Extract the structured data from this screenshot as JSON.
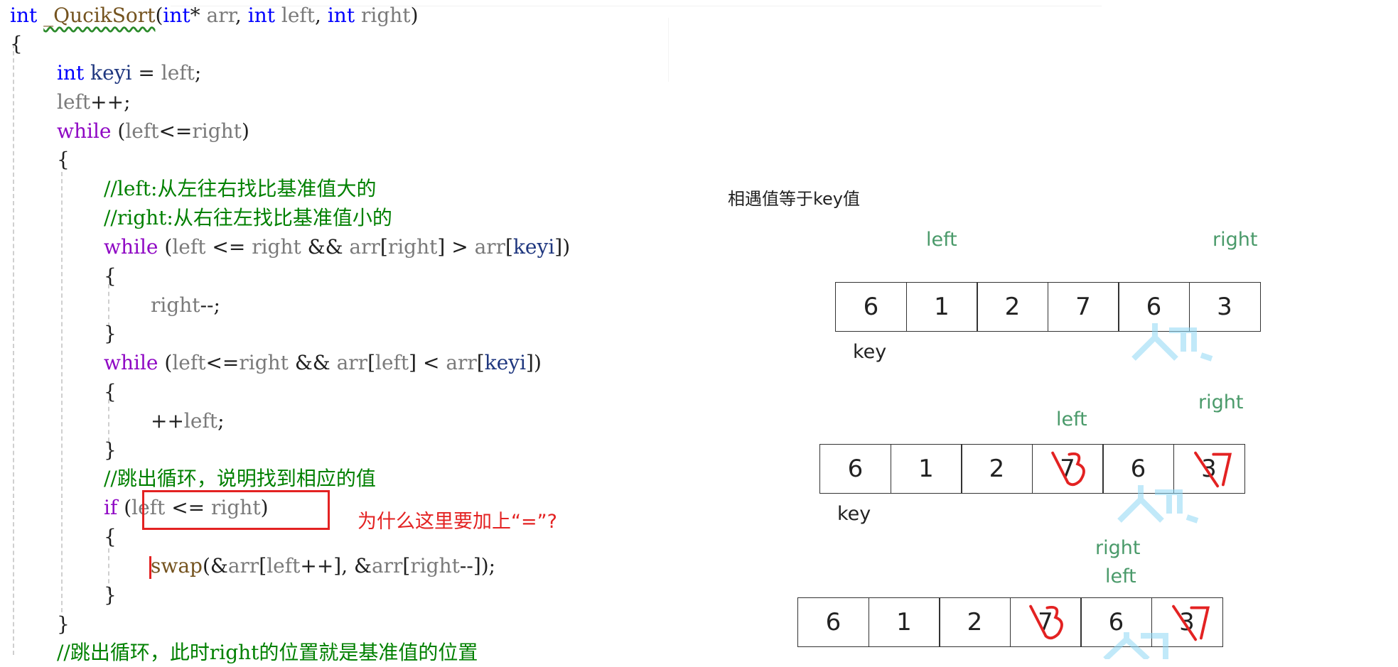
{
  "code": {
    "lines": [
      {
        "segs": [
          [
            "kw",
            "int"
          ],
          [
            "plain",
            " "
          ],
          [
            "fn sq",
            "_QucikSort"
          ],
          [
            "plain",
            "("
          ],
          [
            "kw",
            "int"
          ],
          [
            "plain",
            "* "
          ],
          [
            "id",
            "arr"
          ],
          [
            "plain",
            ", "
          ],
          [
            "kw",
            "int"
          ],
          [
            "plain",
            " "
          ],
          [
            "id",
            "left"
          ],
          [
            "plain",
            ", "
          ],
          [
            "kw",
            "int"
          ],
          [
            "plain",
            " "
          ],
          [
            "id",
            "right"
          ],
          [
            "plain",
            ")"
          ]
        ]
      },
      {
        "segs": [
          [
            "plain",
            "{"
          ]
        ]
      },
      {
        "segs": [
          [
            "kw",
            "int"
          ],
          [
            "plain",
            " "
          ],
          [
            "vr",
            "keyi"
          ],
          [
            "plain",
            " = "
          ],
          [
            "id",
            "left"
          ],
          [
            "plain",
            ";"
          ]
        ]
      },
      {
        "segs": [
          [
            "id",
            "left"
          ],
          [
            "plain",
            "++;"
          ]
        ]
      },
      {
        "segs": [
          [
            "ctl",
            "while"
          ],
          [
            "plain",
            " ("
          ],
          [
            "id",
            "left"
          ],
          [
            "plain",
            "<="
          ],
          [
            "id",
            "right"
          ],
          [
            "plain",
            ")"
          ]
        ]
      },
      {
        "segs": [
          [
            "plain",
            "{"
          ]
        ]
      },
      {
        "segs": [
          [
            "cm",
            "//left:从左往右找比基准值大的"
          ]
        ]
      },
      {
        "segs": [
          [
            "cm",
            "//right:从右往左找比基准值小的"
          ]
        ]
      },
      {
        "segs": [
          [
            "ctl",
            "while"
          ],
          [
            "plain",
            " ("
          ],
          [
            "id",
            "left"
          ],
          [
            "plain",
            " <= "
          ],
          [
            "id",
            "right"
          ],
          [
            "plain",
            " && "
          ],
          [
            "id",
            "arr"
          ],
          [
            "plain",
            "["
          ],
          [
            "id",
            "right"
          ],
          [
            "plain",
            "] > "
          ],
          [
            "id",
            "arr"
          ],
          [
            "plain",
            "["
          ],
          [
            "vr",
            "keyi"
          ],
          [
            "plain",
            "])"
          ]
        ]
      },
      {
        "segs": [
          [
            "plain",
            "{"
          ]
        ]
      },
      {
        "segs": [
          [
            "id",
            "right"
          ],
          [
            "plain",
            "--;"
          ]
        ]
      },
      {
        "segs": [
          [
            "plain",
            "}"
          ]
        ]
      },
      {
        "segs": [
          [
            "ctl",
            "while"
          ],
          [
            "plain",
            " ("
          ],
          [
            "id",
            "left"
          ],
          [
            "plain",
            "<="
          ],
          [
            "id",
            "right"
          ],
          [
            "plain",
            " && "
          ],
          [
            "id",
            "arr"
          ],
          [
            "plain",
            "["
          ],
          [
            "id",
            "left"
          ],
          [
            "plain",
            "] < "
          ],
          [
            "id",
            "arr"
          ],
          [
            "plain",
            "["
          ],
          [
            "vr",
            "keyi"
          ],
          [
            "plain",
            "])"
          ]
        ]
      },
      {
        "segs": [
          [
            "plain",
            "{"
          ]
        ]
      },
      {
        "segs": [
          [
            "plain",
            "++"
          ],
          [
            "id",
            "left"
          ],
          [
            "plain",
            ";"
          ]
        ]
      },
      {
        "segs": [
          [
            "plain",
            "}"
          ]
        ]
      },
      {
        "segs": [
          [
            "cm",
            "//跳出循环，说明找到相应的值"
          ]
        ]
      },
      {
        "segs": [
          [
            "ctl",
            "if"
          ],
          [
            "plain",
            " ("
          ],
          [
            "id",
            "left"
          ],
          [
            "plain",
            " <= "
          ],
          [
            "id",
            "right"
          ],
          [
            "plain",
            ")"
          ]
        ]
      },
      {
        "segs": [
          [
            "plain",
            "{"
          ]
        ]
      },
      {
        "segs": [
          [
            "fn",
            "swap"
          ],
          [
            "plain",
            "(&"
          ],
          [
            "id",
            "arr"
          ],
          [
            "plain",
            "["
          ],
          [
            "id",
            "left"
          ],
          [
            "plain",
            "++], &"
          ],
          [
            "id",
            "arr"
          ],
          [
            "plain",
            "["
          ],
          [
            "id",
            "right"
          ],
          [
            "plain",
            "--]);"
          ]
        ]
      },
      {
        "segs": [
          [
            "plain",
            "}"
          ]
        ]
      },
      {
        "segs": [
          [
            "plain",
            "}"
          ]
        ]
      },
      {
        "segs": [
          [
            "cm",
            "//跳出循环，此时right的位置就是基准值的位置"
          ]
        ]
      }
    ],
    "annotation": "为什么这里要加上“=”?"
  },
  "diagram": {
    "title": "相遇值等于key值",
    "rows": [
      {
        "values": [
          "6",
          "1",
          "2",
          "7",
          "6",
          "3"
        ],
        "crossed": [],
        "labels": {
          "left": "left",
          "right": "right",
          "key": "key"
        }
      },
      {
        "values": [
          "6",
          "1",
          "2",
          "7",
          "6",
          "3"
        ],
        "crossed": [
          3,
          5
        ],
        "labels": {
          "left": "left",
          "right": "right",
          "key": "key"
        }
      },
      {
        "values": [
          "6",
          "1",
          "2",
          "7",
          "6",
          "3"
        ],
        "crossed": [
          3,
          5
        ],
        "labels": {
          "right": "right",
          "left": "left"
        }
      }
    ]
  },
  "colors": {
    "keyword": "#0000ff",
    "control": "#8f08c4",
    "comment": "#008000",
    "annotation": "#e32222",
    "pointer_label": "#4a9a6a"
  }
}
